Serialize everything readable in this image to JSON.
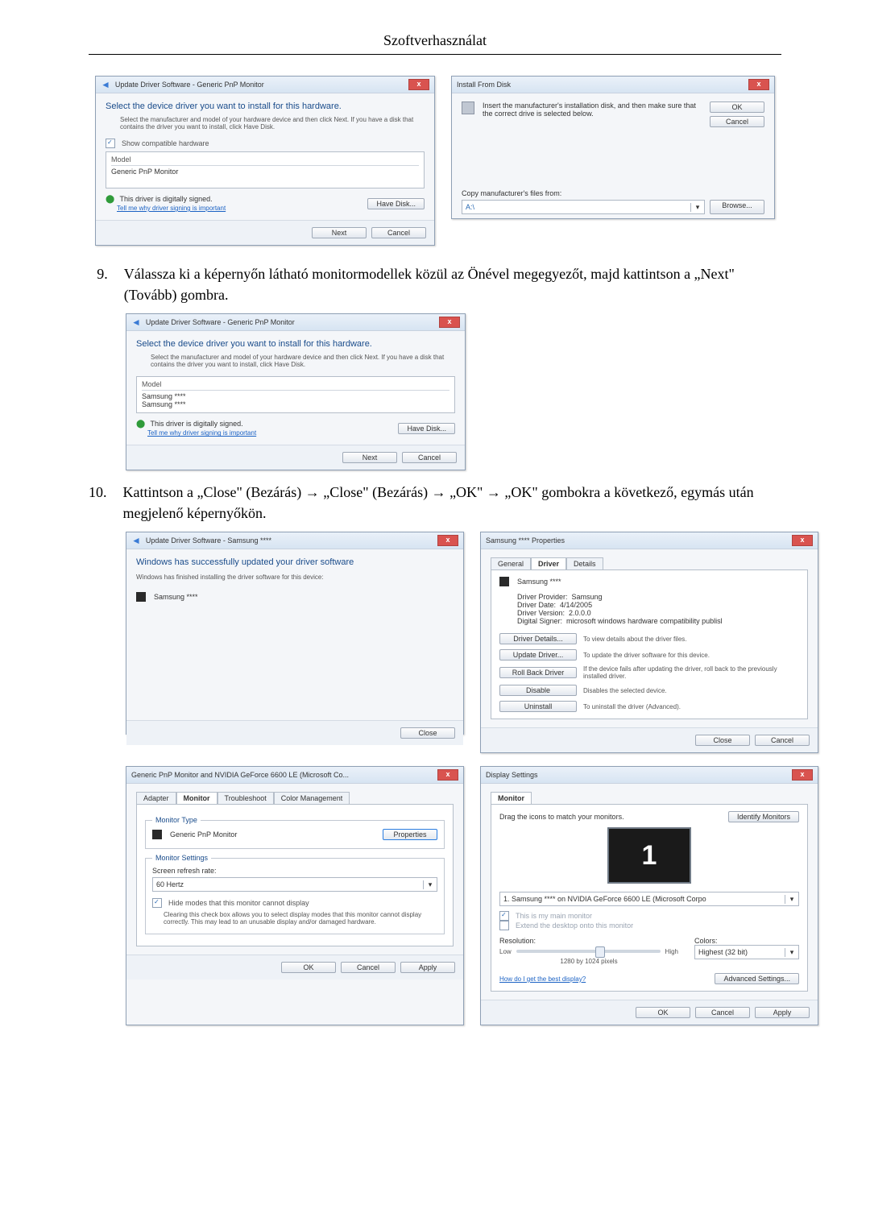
{
  "page": {
    "header": "Szoftverhasználat"
  },
  "fig1": {
    "left": {
      "title": "Update Driver Software - Generic PnP Monitor",
      "instruction": "Select the device driver you want to install for this hardware.",
      "hint": "Select the manufacturer and model of your hardware device and then click Next. If you have a disk that contains the driver you want to install, click Have Disk.",
      "compat": "Show compatible hardware",
      "model_hdr": "Model",
      "model1": "Generic PnP Monitor",
      "signed": "This driver is digitally signed.",
      "signed_link": "Tell me why driver signing is important",
      "have_disk": "Have Disk...",
      "next": "Next",
      "cancel": "Cancel"
    },
    "right": {
      "title": "Install From Disk",
      "instruction": "Insert the manufacturer's installation disk, and then make sure that the correct drive is selected below.",
      "ok": "OK",
      "cancel": "Cancel",
      "copy_label": "Copy manufacturer's files from:",
      "path": "A:\\",
      "browse": "Browse..."
    }
  },
  "step9": {
    "num": "9.",
    "text": "Válassza ki a képernyőn látható monitormodellek közül az Önével megegyezőt, majd kattintson a „Next\" (Tovább) gombra."
  },
  "fig2": {
    "title": "Update Driver Software - Generic PnP Monitor",
    "instruction": "Select the device driver you want to install for this hardware.",
    "hint": "Select the manufacturer and model of your hardware device and then click Next. If you have a disk that contains the driver you want to install, click Have Disk.",
    "model_hdr": "Model",
    "model1": "Samsung ****",
    "model2": "Samsung ****",
    "signed": "This driver is digitally signed.",
    "signed_link": "Tell me why driver signing is important",
    "have_disk": "Have Disk...",
    "next": "Next",
    "cancel": "Cancel"
  },
  "step10": {
    "num": "10.",
    "text": "Kattintson a „Close\" (Bezárás) → „Close\" (Bezárás) → „OK\" → „OK\" gombokra a következő, egymás után megjelenő képernyőkön."
  },
  "fig3": {
    "tl": {
      "title": "Update Driver Software - Samsung ****",
      "msg": "Windows has successfully updated your driver software",
      "sub": "Windows has finished installing the driver software for this device:",
      "device": "Samsung ****",
      "close": "Close"
    },
    "tr": {
      "title": "Samsung **** Properties",
      "tab_general": "General",
      "tab_driver": "Driver",
      "tab_details": "Details",
      "device": "Samsung ****",
      "provider_l": "Driver Provider:",
      "provider_v": "Samsung",
      "date_l": "Driver Date:",
      "date_v": "4/14/2005",
      "version_l": "Driver Version:",
      "version_v": "2.0.0.0",
      "signer_l": "Digital Signer:",
      "signer_v": "microsoft windows hardware compatibility publisl",
      "btn_details": "Driver Details...",
      "btn_details_desc": "To view details about the driver files.",
      "btn_update": "Update Driver...",
      "btn_update_desc": "To update the driver software for this device.",
      "btn_rollback": "Roll Back Driver",
      "btn_rollback_desc": "If the device fails after updating the driver, roll back to the previously installed driver.",
      "btn_disable": "Disable",
      "btn_disable_desc": "Disables the selected device.",
      "btn_uninstall": "Uninstall",
      "btn_uninstall_desc": "To uninstall the driver (Advanced).",
      "close": "Close",
      "cancel": "Cancel"
    },
    "bl": {
      "title": "Generic PnP Monitor and NVIDIA GeForce 6600 LE (Microsoft Co...",
      "tab_adapter": "Adapter",
      "tab_monitor": "Monitor",
      "tab_trouble": "Troubleshoot",
      "tab_color": "Color Management",
      "type_legend": "Monitor Type",
      "type_value": "Generic PnP Monitor",
      "properties": "Properties",
      "settings_legend": "Monitor Settings",
      "refresh_label": "Screen refresh rate:",
      "refresh_value": "60 Hertz",
      "hide_label": "Hide modes that this monitor cannot display",
      "hide_desc": "Clearing this check box allows you to select display modes that this monitor cannot display correctly. This may lead to an unusable display and/or damaged hardware.",
      "ok": "OK",
      "cancel": "Cancel",
      "apply": "Apply"
    },
    "br": {
      "title": "Display Settings",
      "tab_monitor": "Monitor",
      "drag": "Drag the icons to match your monitors.",
      "identify": "Identify Monitors",
      "thumb": "1",
      "combo": "1. Samsung **** on NVIDIA GeForce 6600 LE (Microsoft Corpo",
      "main": "This is my main monitor",
      "extend": "Extend the desktop onto this monitor",
      "res_label": "Resolution:",
      "low": "Low",
      "high": "High",
      "res_value": "1280 by 1024 pixels",
      "colors_label": "Colors:",
      "colors_value": "Highest (32 bit)",
      "best_link": "How do I get the best display?",
      "advanced": "Advanced Settings...",
      "ok": "OK",
      "cancel": "Cancel",
      "apply": "Apply"
    }
  }
}
